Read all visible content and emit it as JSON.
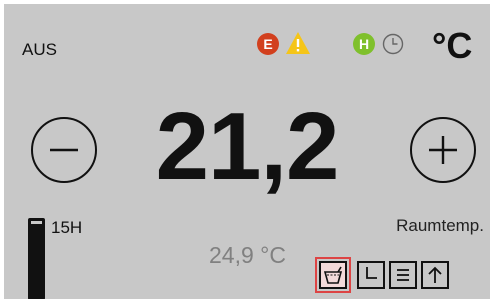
{
  "header": {
    "mode": "AUS",
    "error_badge": "E",
    "holiday_badge": "H",
    "unit": "°C",
    "icons": [
      "warning-icon",
      "clock-icon"
    ]
  },
  "main": {
    "setpoint": "21,2",
    "minus_icon": "minus-icon",
    "plus_icon": "plus-icon"
  },
  "footer": {
    "level_text": "15H",
    "level_fraction": 0.96,
    "sensor_label": "Raumtemp.",
    "actual_temp": "24,9 °C",
    "buttons": [
      "basin-icon",
      "timer-icon",
      "menu-icon",
      "arrow-up-icon"
    ]
  },
  "colors": {
    "background": "#c8c8c8",
    "error": "#d2401e",
    "warning": "#f5c518",
    "holiday": "#7fc02c",
    "selected_border": "#dd4444"
  }
}
